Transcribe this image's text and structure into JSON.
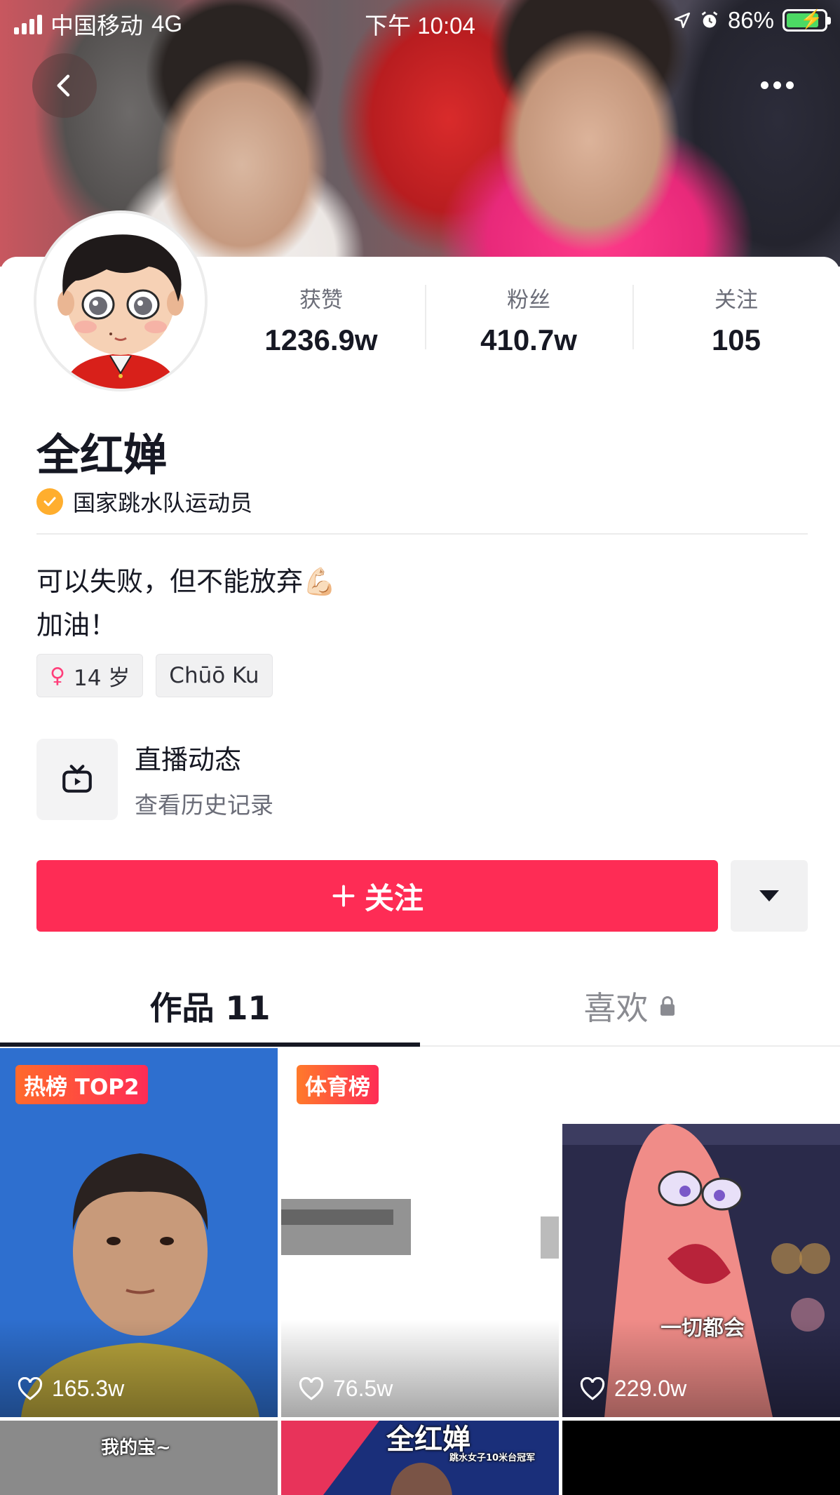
{
  "status_bar": {
    "carrier": "中国移动",
    "network": "4G",
    "time": "下午 10:04",
    "battery": "86%"
  },
  "profile": {
    "stats": [
      {
        "label": "获赞",
        "value": "1236.9w"
      },
      {
        "label": "粉丝",
        "value": "410.7w"
      },
      {
        "label": "关注",
        "value": "105"
      }
    ],
    "name": "全红婵",
    "verification": "国家跳水队运动员",
    "bio_line1": "可以失败，但不能放弃💪🏻",
    "bio_line2": "加油！",
    "tags": [
      {
        "icon": "female-icon",
        "label": "14 岁"
      },
      {
        "label": "Chūō Ku"
      }
    ],
    "live": {
      "title": "直播动态",
      "subtitle": "查看历史记录"
    },
    "follow_button": "关注"
  },
  "tabs": [
    {
      "label": "作品 11",
      "active": true
    },
    {
      "label": "喜欢",
      "active": false,
      "locked": true
    }
  ],
  "videos": [
    {
      "badge": "热榜 TOP2",
      "likes": "165.3w"
    },
    {
      "badge": "体育榜",
      "likes": "76.5w"
    },
    {
      "caption": "一切都会",
      "likes": "229.0w"
    },
    {
      "caption": "我的宝~"
    },
    {
      "caption": "全红婵",
      "subcaption": "跳水女子10米台冠军"
    },
    {}
  ],
  "colors": {
    "accent": "#fe2c55",
    "verify_badge": "#ffae2e",
    "text_primary": "#161823",
    "text_secondary": "#6b6d78"
  }
}
